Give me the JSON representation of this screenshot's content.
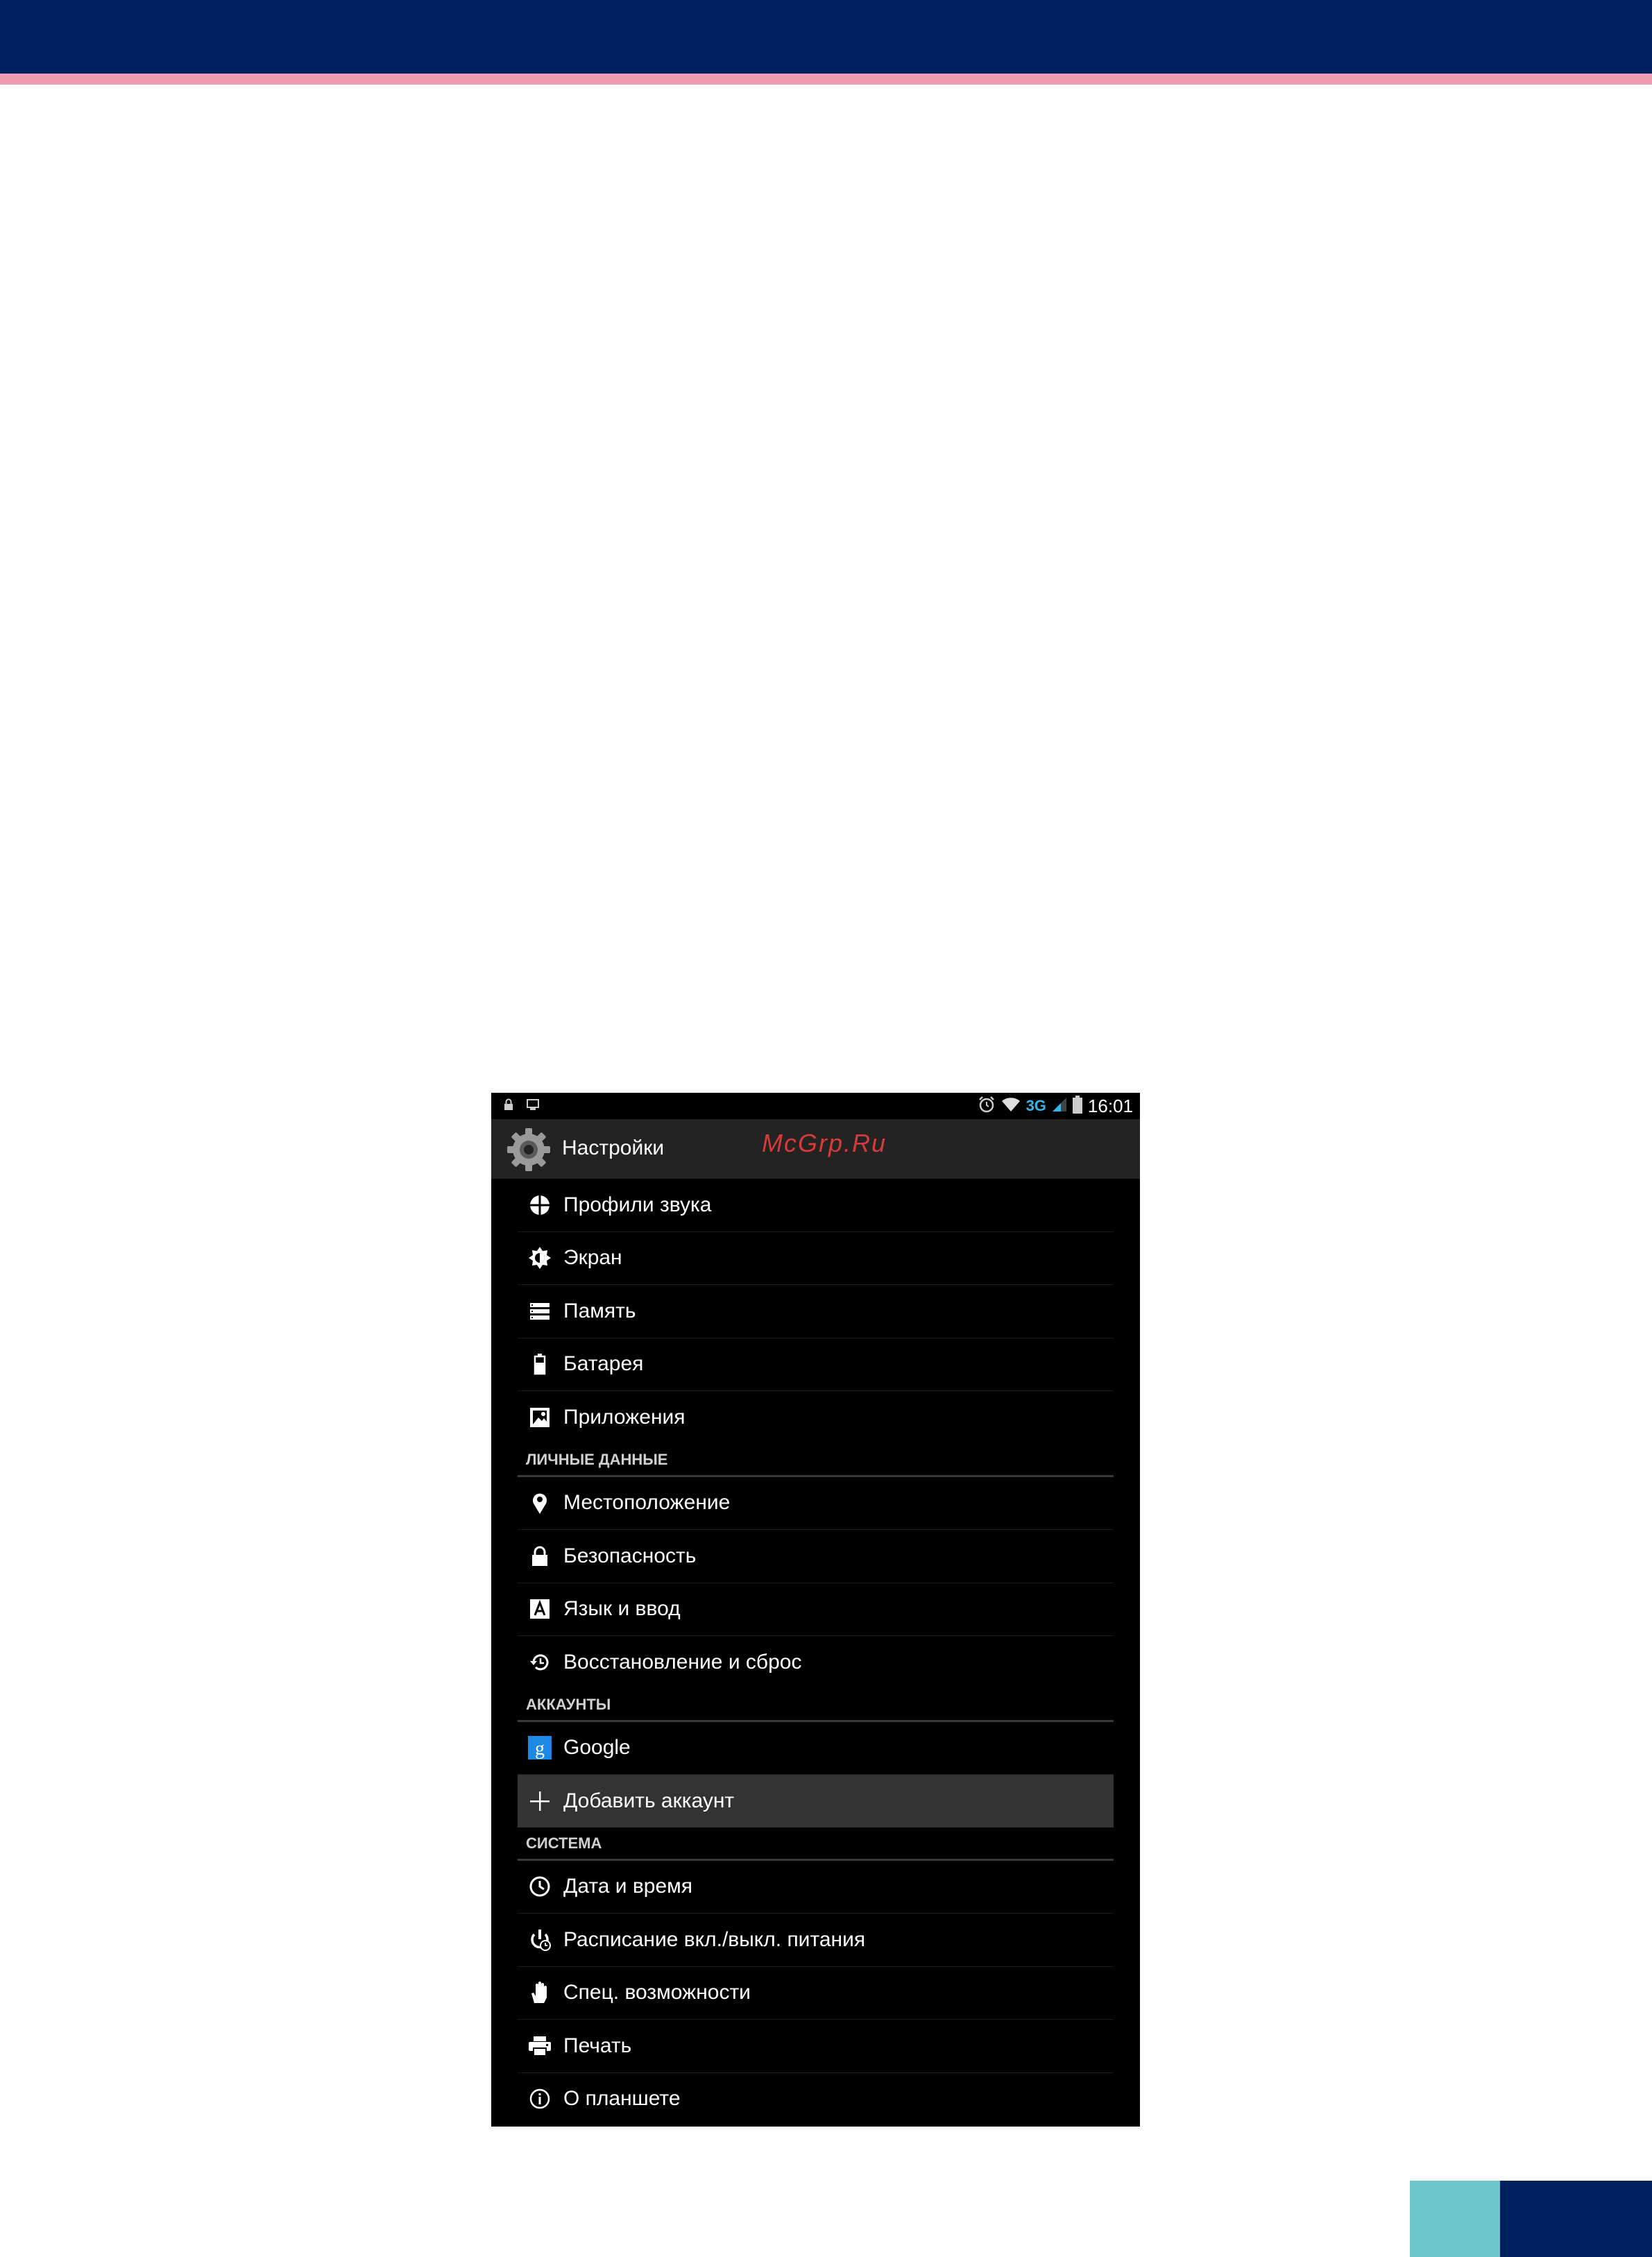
{
  "colors": {
    "header_navy": "#002060",
    "header_stripe": "#ee9bb4",
    "corner_teal": "#6cc6c8",
    "phone_background": "#000000",
    "action_bar": "#232323",
    "selected_row": "#333333",
    "signal_blue": "#33b5e5",
    "watermark_red": "#d73a3a"
  },
  "status_bar": {
    "network": "3G",
    "time": "16:01",
    "icons": [
      "lock-icon",
      "screenshot-icon",
      "alarm-icon",
      "wifi-icon",
      "signal-icon",
      "battery-icon"
    ]
  },
  "action_bar": {
    "title": "Настройки",
    "icon": "gear-icon"
  },
  "watermark": "McGrp.Ru",
  "settings": {
    "device": [
      {
        "label": "Профили звука",
        "icon": "sound-profile-icon"
      },
      {
        "label": "Экран",
        "icon": "display-icon"
      },
      {
        "label": "Память",
        "icon": "storage-icon"
      },
      {
        "label": "Батарея",
        "icon": "battery-icon"
      },
      {
        "label": "Приложения",
        "icon": "apps-icon"
      }
    ],
    "personal_header": "ЛИЧНЫЕ ДАННЫЕ",
    "personal": [
      {
        "label": "Местоположение",
        "icon": "location-icon"
      },
      {
        "label": "Безопасность",
        "icon": "lock-icon"
      },
      {
        "label": "Язык и ввод",
        "icon": "keyboard-icon"
      },
      {
        "label": "Восстановление и сброс",
        "icon": "restore-icon"
      }
    ],
    "accounts_header": "АККАУНТЫ",
    "accounts": [
      {
        "label": "Google",
        "icon": "google-icon"
      },
      {
        "label": "Добавить аккаунт",
        "icon": "plus-icon",
        "selected": true
      }
    ],
    "system_header": "СИСТЕМА",
    "system": [
      {
        "label": "Дата и время",
        "icon": "clock-icon"
      },
      {
        "label": "Расписание вкл./выкл. питания",
        "icon": "power-schedule-icon"
      },
      {
        "label": "Спец. возможности",
        "icon": "accessibility-icon"
      },
      {
        "label": "Печать",
        "icon": "printer-icon"
      },
      {
        "label": "О планшете",
        "icon": "info-icon"
      }
    ]
  }
}
